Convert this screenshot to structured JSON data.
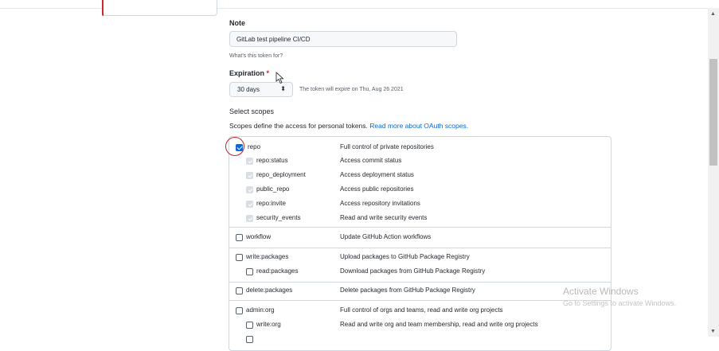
{
  "note": {
    "label": "Note",
    "value": "GitLab test pipeline CI/CD",
    "help": "What's this token for?"
  },
  "expiration": {
    "label": "Expiration",
    "required_mark": "*",
    "selected": "30 days",
    "arrow": "⬍",
    "info": "The token will expire on Thu, Aug 26 2021"
  },
  "scopes": {
    "heading": "Select scopes",
    "intro": "Scopes define the access for personal tokens.",
    "link": "Read more about OAuth scopes.",
    "items": [
      {
        "name": "repo",
        "desc": "Full control of private repositories"
      },
      {
        "name": "repo:status",
        "desc": "Access commit status"
      },
      {
        "name": "repo_deployment",
        "desc": "Access deployment status"
      },
      {
        "name": "public_repo",
        "desc": "Access public repositories"
      },
      {
        "name": "repo:invite",
        "desc": "Access repository invitations"
      },
      {
        "name": "security_events",
        "desc": "Read and write security events"
      },
      {
        "name": "workflow",
        "desc": "Update GitHub Action workflows"
      },
      {
        "name": "write:packages",
        "desc": "Upload packages to GitHub Package Registry"
      },
      {
        "name": "read:packages",
        "desc": "Download packages from GitHub Package Registry"
      },
      {
        "name": "delete:packages",
        "desc": "Delete packages from GitHub Package Registry"
      },
      {
        "name": "admin:org",
        "desc": "Full control of orgs and teams, read and write org projects"
      },
      {
        "name": "write:org",
        "desc": "Read and write org and team membership, read and write org projects"
      }
    ]
  },
  "watermark": {
    "title": "Activate Windows",
    "subtitle": "Go to Settings to activate Windows."
  },
  "scrollbar": {
    "up": "▲",
    "down": "▼"
  }
}
